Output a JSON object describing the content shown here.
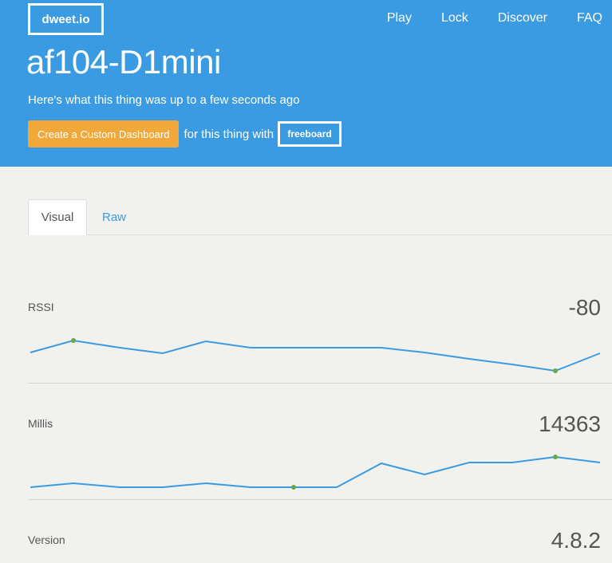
{
  "header": {
    "logo": "dweet.io",
    "nav": [
      "Play",
      "Lock",
      "Discover",
      "FAQ"
    ],
    "title": "af104-D1mini",
    "subtitle": "Here's what this thing was up to a few seconds ago",
    "dashboard_button": "Create a Custom Dashboard",
    "dashboard_text": "for this thing with",
    "freeboard": "freeboard"
  },
  "tabs": [
    "Visual",
    "Raw"
  ],
  "colors": {
    "header": "#3b9be2",
    "button": "#f0a83a",
    "line": "#3b9be2",
    "point": "#6aa84f"
  },
  "metrics": [
    {
      "label": "RSSI",
      "value": "-80"
    },
    {
      "label": "Millis",
      "value": "14363"
    },
    {
      "label": "Version",
      "value": "4.8.2"
    }
  ]
}
